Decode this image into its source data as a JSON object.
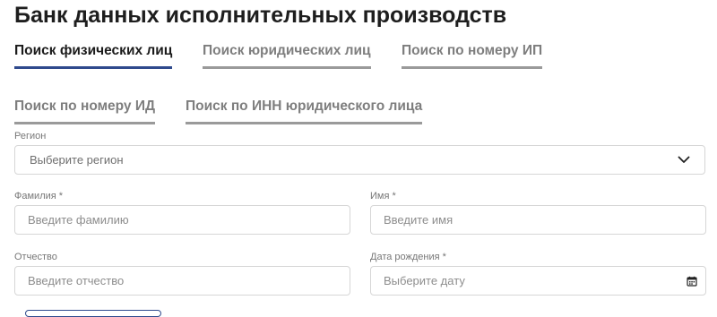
{
  "page": {
    "title": "Банк данных исполнительных производств"
  },
  "tabs": [
    {
      "label": "Поиск физических лиц",
      "active": true
    },
    {
      "label": "Поиск юридических лиц",
      "active": false
    },
    {
      "label": "Поиск по номеру ИП",
      "active": false
    },
    {
      "label": "Поиск по номеру ИД",
      "active": false
    },
    {
      "label": "Поиск по ИНН юридического лица",
      "active": false
    }
  ],
  "form": {
    "region": {
      "label": "Регион",
      "placeholder": "Выберите регион",
      "icon": "chevron-down-icon"
    },
    "last_name": {
      "label": "Фамилия *",
      "placeholder": "Введите фамилию",
      "value": ""
    },
    "first_name": {
      "label": "Имя *",
      "placeholder": "Введите имя",
      "value": ""
    },
    "patronymic": {
      "label": "Отчество",
      "placeholder": "Введите отчество",
      "value": ""
    },
    "birth_date": {
      "label": "Дата рождения *",
      "placeholder": "Выберите дату",
      "icon": "calendar-icon"
    }
  },
  "colors": {
    "active_tab_underline": "#2f4a8d",
    "inactive_tab_underline": "#9a9a9a",
    "border": "#d6d6d6"
  }
}
